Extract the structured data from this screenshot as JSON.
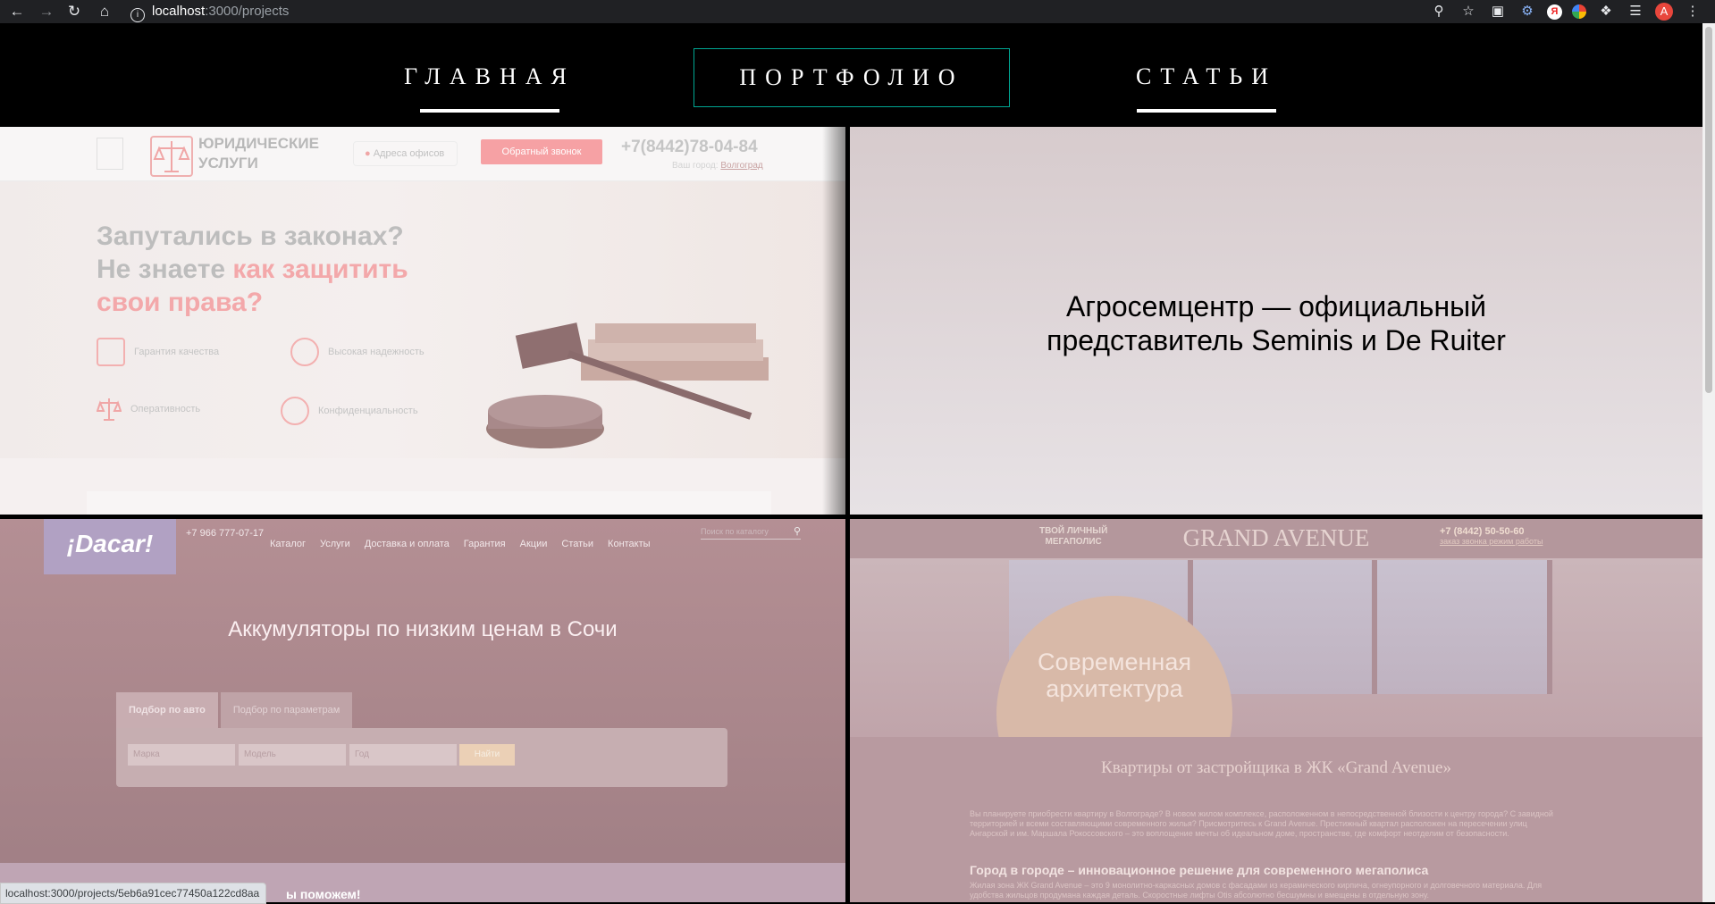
{
  "browser": {
    "url_host": "localhost",
    "url_path": ":3000/projects",
    "avatar_letter": "A",
    "yandex_letter": "Я"
  },
  "nav": {
    "items": [
      {
        "label": "ГЛАВНАЯ",
        "active": false
      },
      {
        "label": "ПОРТФОЛИО",
        "active": true
      },
      {
        "label": "СТАТЬИ",
        "active": false
      }
    ],
    "active_border_color": "#00a693"
  },
  "projects": {
    "legal": {
      "logo_text_1": "ЮРИДИЧЕСКИЕ",
      "logo_text_2": "УСЛУГИ",
      "address_btn": "Адреса офисов",
      "callback_btn": "Обратный звонок",
      "phone": "+7(8442)78-04-84",
      "region_label": "Ваш город:",
      "region_city": "Волгоград",
      "headline_1": "Запутались в законах?",
      "headline_2a": "Не знаете ",
      "headline_2b": "как защитить",
      "headline_3": "свои права?",
      "features": [
        "Гарантия качества",
        "Высокая надежность",
        "Оперативность",
        "Конфиденциальность"
      ]
    },
    "agro": {
      "title_line_1": "Агросемцентр — официальный",
      "title_line_2": "представитель Seminis и De Ruiter"
    },
    "dacar": {
      "logo": "¡Dacar!",
      "phone": "+7 966 777-07-17",
      "menu": [
        "Каталог",
        "Услуги",
        "Доставка и оплата",
        "Гарантия",
        "Акции",
        "Статьи",
        "Контакты"
      ],
      "search_placeholder": "Поиск по каталогу",
      "heading": "Аккумуляторы по низким ценам в Сочи",
      "tab_auto": "Подбор по авто",
      "tab_params": "Подбор по параметрам",
      "select_make": "Марка",
      "select_model": "Модель",
      "select_year": "Год",
      "find_btn": "Найти",
      "bottom_text": "ы поможем!"
    },
    "grand": {
      "tagline_1": "ТВОЙ ЛИЧНЫЙ",
      "tagline_2": "МЕГАПОЛИС",
      "brand": "GRAND AVENUE",
      "phone": "+7 (8442) 50-50-60",
      "phone_links": "заказ звонка   режим работы",
      "circle_1": "Современная",
      "circle_2": "архитектура",
      "heading": "Квартиры от застройщика в ЖК «Grand Avenue»",
      "paragraph": "Вы планируете приобрести квартиру в Волгограде? В новом жилом комплексе, расположенном в непосредственной близости к центру города? С завидной территорией и всеми составляющими современного жилья? Присмотритесь к Grand Avenue. Престижный квартал расположен на пересечении улиц Ангарской и им. Маршала Рокоссовского – это воплощение мечты об идеальном доме, пространстве, где комфорт неотделим от безопасности.",
      "subheading": "Город в городе – инновационное решение для современного мегаполиса",
      "paragraph_2": "Жилая зона ЖК Grand Avenue – это 9 монолитно-каркасных домов с фасадами из керамического кирпича, огнеупорного и долговечного материала. Для удобства жильцов продумана каждая деталь. Скоростные лифты Otis абсолютно бесшумны и вмещены в отдельную зону."
    }
  },
  "status_bar": "localhost:3000/projects/5eb6a91cec77450a122cd8aa"
}
